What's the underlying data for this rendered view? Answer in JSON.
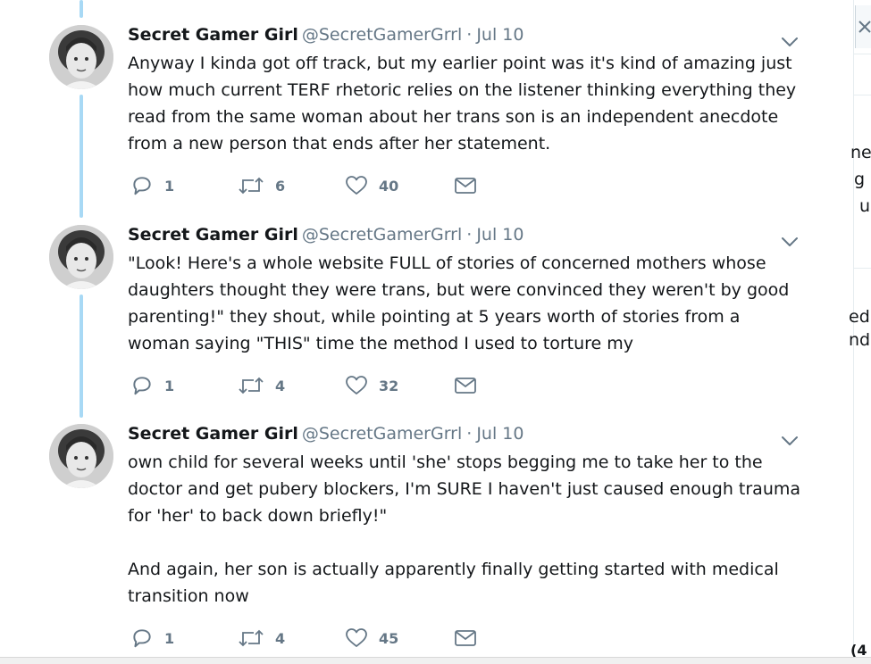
{
  "tweets": [
    {
      "name": "Secret Gamer Girl",
      "handle": "@SecretGamerGrrl",
      "separator": "·",
      "date": "Jul 10",
      "paragraphs": [
        "Anyway I kinda got off track, but my earlier point was it's kind of amazing just how much current TERF rhetoric relies on the listener thinking everything they read from the same woman about her trans son is an independent anecdote from a new person that ends after her statement."
      ],
      "replies": "1",
      "retweets": "6",
      "likes": "40"
    },
    {
      "name": "Secret Gamer Girl",
      "handle": "@SecretGamerGrrl",
      "separator": "·",
      "date": "Jul 10",
      "paragraphs": [
        "\"Look! Here's a whole website FULL of stories of concerned mothers whose daughters thought they were trans, but were convinced they weren't by good parenting!\" they shout, while pointing at 5 years worth of stories from a woman saying \"THIS\" time the method I used to torture my"
      ],
      "replies": "1",
      "retweets": "4",
      "likes": "32"
    },
    {
      "name": "Secret Gamer Girl",
      "handle": "@SecretGamerGrrl",
      "separator": "·",
      "date": "Jul 10",
      "paragraphs": [
        "own child for several weeks until 'she' stops begging me to take her to the doctor and get pubery blockers, I'm SURE I haven't just caused enough trauma for 'her' to back down briefly!\"",
        "And again, her son is actually apparently finally getting started with medical transition now"
      ],
      "replies": "1",
      "retweets": "4",
      "likes": "45"
    }
  ],
  "right_panel_fragments": [
    "ne",
    "g",
    "u",
    "ed",
    "nd",
    "(4"
  ],
  "colors": {
    "thread_line": "#a8d9f5",
    "secondary_text": "#657786",
    "primary_text": "#14171a",
    "divider": "#e6ecf0"
  },
  "icons": {
    "reply": "reply-icon",
    "retweet": "retweet-icon",
    "like": "heart-icon",
    "dm": "envelope-icon",
    "menu": "chevron-down-icon"
  }
}
